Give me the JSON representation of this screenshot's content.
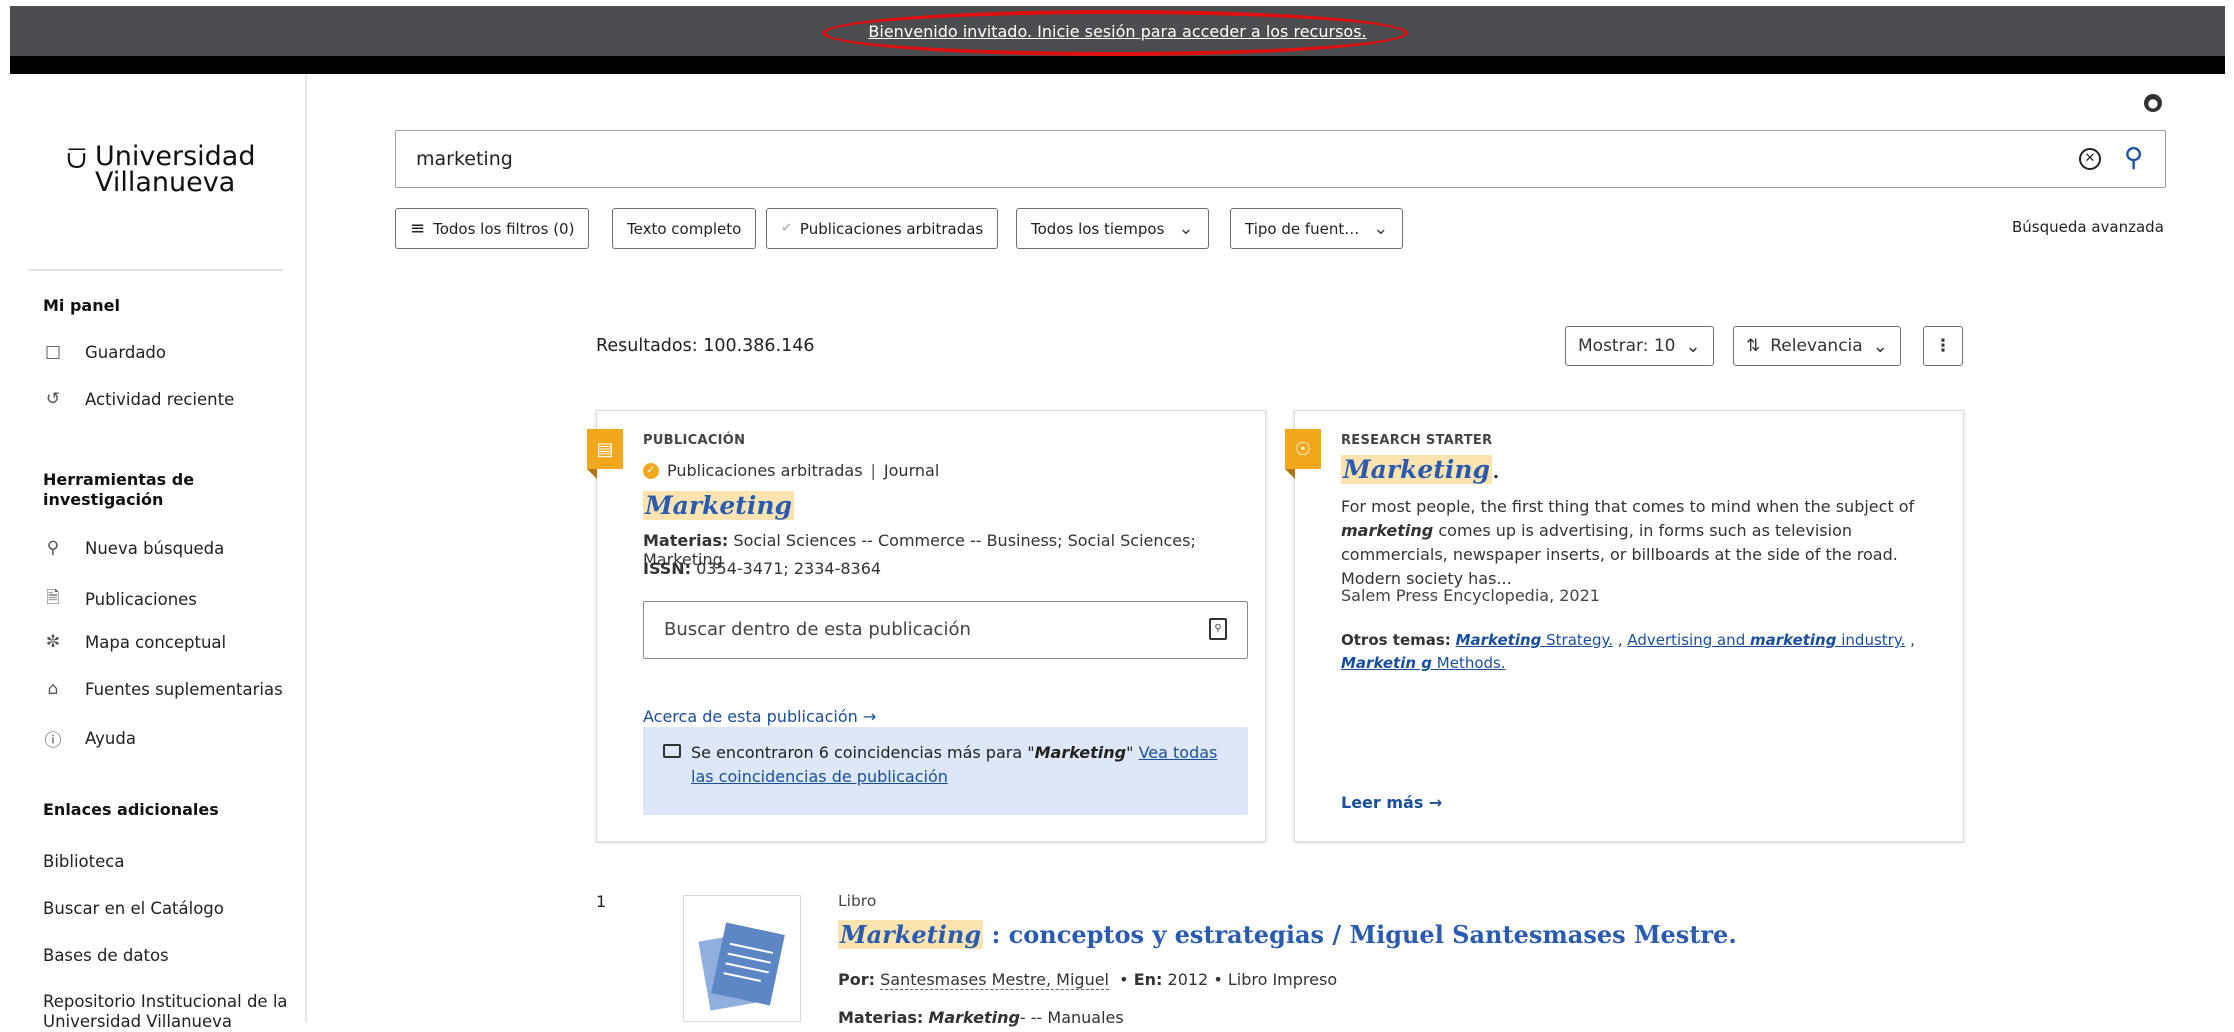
{
  "banner": {
    "text": "Bienvenido invitado. Inicie sesión para acceder a los recursos."
  },
  "logo": {
    "line1": "Universidad",
    "line2": "Villanueva",
    "mark": "⩂"
  },
  "sidebar": {
    "panel_heading": "Mi panel",
    "panel_items": [
      {
        "label": "Guardado",
        "icon": "bookmark-icon"
      },
      {
        "label": "Actividad reciente",
        "icon": "history-icon"
      }
    ],
    "tools_heading": "Herramientas de investigación",
    "tools_items": [
      {
        "label": "Nueva búsqueda",
        "icon": "search-icon"
      },
      {
        "label": "Publicaciones",
        "icon": "document-icon"
      },
      {
        "label": "Mapa conceptual",
        "icon": "concept-map-icon"
      },
      {
        "label": "Fuentes suplementarias",
        "icon": "bank-icon"
      },
      {
        "label": "Ayuda",
        "icon": "help-icon"
      }
    ],
    "links_heading": "Enlaces adicionales",
    "links": [
      "Biblioteca",
      "Buscar en el Catálogo",
      "Bases de datos",
      "Repositorio Institucional de la Universidad Villanueva"
    ]
  },
  "search": {
    "value": "marketing",
    "placeholder": ""
  },
  "filters": {
    "all": "Todos los filtros (0)",
    "fulltext": "Texto completo",
    "peer": "Publicaciones arbitradas",
    "time": "Todos los tiempos",
    "source": "Tipo de fuent…",
    "advanced": "Búsqueda avanzada"
  },
  "results": {
    "count_label": "Resultados: 100.386.146",
    "show": "Mostrar: 10",
    "sort": "Relevancia"
  },
  "pub_card": {
    "kicker": "PUBLICACIÓN",
    "peer": "Publicaciones arbitradas",
    "sep": "|",
    "type": "Journal",
    "title": "Marketing",
    "materias_label": "Materias:",
    "materias": "Social Sciences -- Commerce -- Business; Social Sciences; Marketing",
    "issn_label": "ISSN:",
    "issn": "0354-3471; 2334-8364",
    "inner_search_placeholder": "Buscar dentro de esta publicación",
    "about": "Acerca de esta publicación →",
    "match_prefix": "Se encontraron 6 coincidencias más para \"",
    "match_term": "Marketing",
    "match_suffix": "\" ",
    "match_link": "Vea todas las coincidencias de publicación"
  },
  "rs_card": {
    "kicker": "RESEARCH STARTER",
    "title": "Marketing",
    "title_suffix": ".",
    "desc_a": "For most people, the first thing that comes to mind when the subject of ",
    "desc_term": "marketing",
    "desc_b": " comes up is advertising, in forms such as television commercials, newspaper inserts, or billboards at the side of the road. Modern society has...",
    "source": "Salem Press Encyclopedia, 2021",
    "topics_label": "Otros temas:",
    "topic1_term": "Marketing",
    "topic1_rest": " Strategy.",
    "topic2_a": "Advertising and ",
    "topic2_term": "marketing",
    "topic2_b": " industry.",
    "topic3_term": "Marketin g",
    "topic3_rest": " Methods.",
    "read_more": "Leer más →"
  },
  "result1": {
    "num": "1",
    "type": "Libro",
    "title_term": "Marketing",
    "title_rest": " : conceptos y estrategias / Miguel Santesmases Mestre.",
    "by_label": "Por:",
    "author": "Santesmases Mestre, Miguel",
    "en_label": "En:",
    "year_type": "2012 • Libro Impreso",
    "mat_label": "Materias:",
    "mat_term": "Marketing",
    "mat_rest": "- -- Manuales"
  },
  "colors": {
    "accent": "#2a5bb0",
    "highlight": "#fde3b0",
    "badge": "#f2a81d",
    "banner": "#4b4d50",
    "match_bg": "#dde7f7"
  }
}
